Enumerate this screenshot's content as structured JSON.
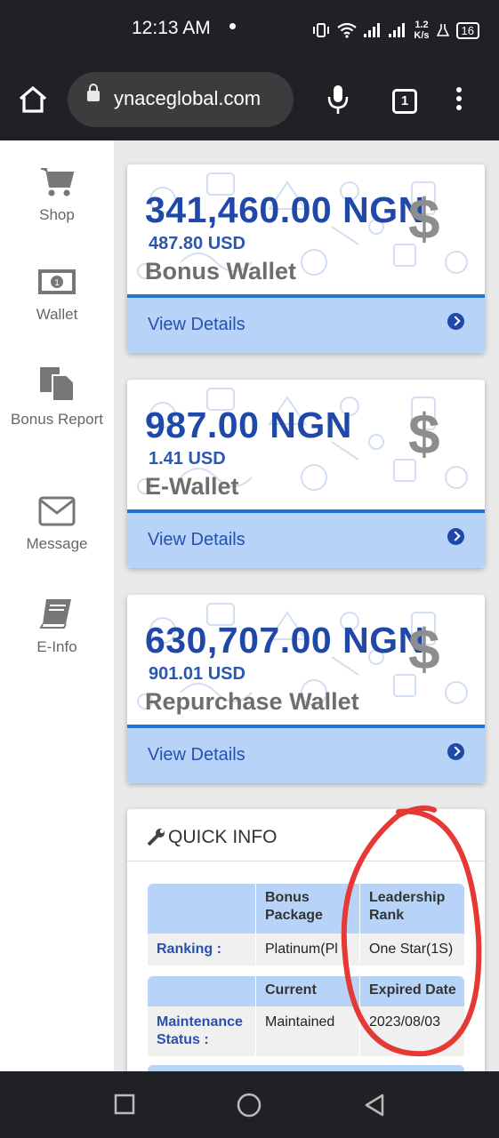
{
  "status_bar": {
    "time": "12:13 AM",
    "net_speed": "1.2",
    "net_unit": "K/s",
    "battery": "16"
  },
  "browser": {
    "url": "ynaceglobal.com",
    "tab_count": "1"
  },
  "sidebar": {
    "items": [
      {
        "label": "Shop",
        "icon": "cart-icon"
      },
      {
        "label": "Wallet",
        "icon": "money-icon"
      },
      {
        "label": "Bonus Report",
        "icon": "copy-icon"
      },
      {
        "label": "Message",
        "icon": "envelope-icon"
      },
      {
        "label": "E-Info",
        "icon": "book-icon"
      }
    ]
  },
  "cards": [
    {
      "amount": "341,460.00 NGN",
      "usd": "487.80 USD",
      "label": "Bonus Wallet",
      "link": "View Details"
    },
    {
      "amount": "987.00 NGN",
      "usd": "1.41 USD",
      "label": "E-Wallet",
      "link": "View Details"
    },
    {
      "amount": "630,707.00 NGN",
      "usd": "901.01 USD",
      "label": "Repurchase Wallet",
      "link": "View Details"
    }
  ],
  "dollar_sign": "$",
  "quick_info": {
    "title": "QUICK INFO",
    "ranking_table": {
      "headers": [
        "",
        "Bonus Package",
        "Leadership Rank"
      ],
      "row_label": "Ranking :",
      "values": [
        "Platinum(Pl",
        "One Star(1S)"
      ]
    },
    "maintenance_table": {
      "headers": [
        "",
        "Current",
        "Expired Date"
      ],
      "row_label": "Maintenance Status :",
      "values": [
        "Maintained",
        "2023/08/03"
      ]
    }
  },
  "colors": {
    "accent": "#1f48a8",
    "footer_bg": "#b7d4f8",
    "annotation": "#e53935"
  }
}
